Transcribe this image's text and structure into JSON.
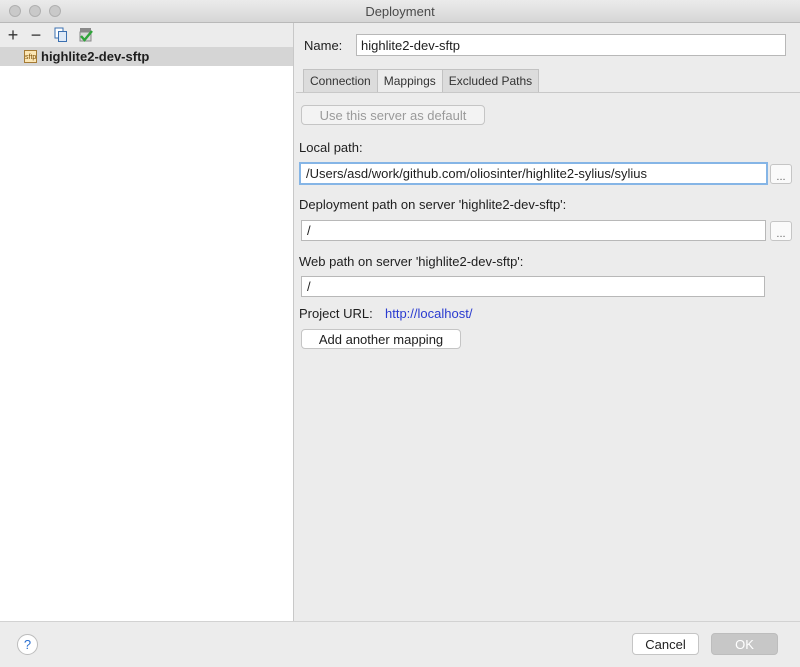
{
  "window": {
    "title": "Deployment"
  },
  "toolbar": {
    "add": "+",
    "remove": "−"
  },
  "servers": [
    {
      "label": "highlite2-dev-sftp",
      "badge": "sftp"
    }
  ],
  "form": {
    "name_label": "Name:",
    "name_value": "highlite2-dev-sftp",
    "tabs": [
      {
        "label": "Connection"
      },
      {
        "label": "Mappings"
      },
      {
        "label": "Excluded Paths"
      }
    ],
    "default_button": "Use this server as default",
    "local_path_label": "Local path:",
    "local_path_value": "/Users/asd/work/github.com/oliosinter/highlite2-sylius/sylius",
    "deployment_path_label": "Deployment path on server 'highlite2-dev-sftp':",
    "deployment_path_value": "/",
    "web_path_label": "Web path on server 'highlite2-dev-sftp':",
    "web_path_value": "/",
    "project_url_label": "Project URL:",
    "project_url_value": "http://localhost/",
    "add_mapping_button": "Add another mapping",
    "browse": "..."
  },
  "footer": {
    "help": "?",
    "cancel": "Cancel",
    "ok": "OK"
  }
}
